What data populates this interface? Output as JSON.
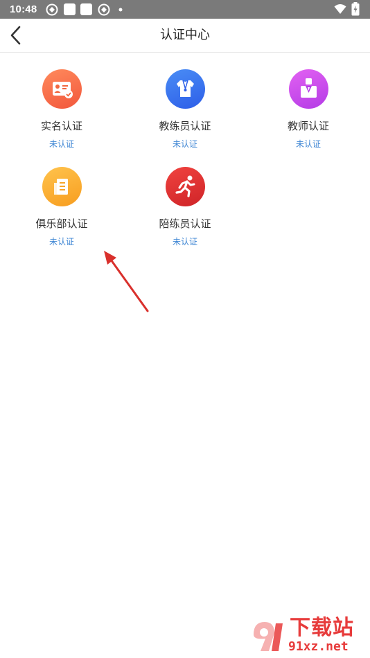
{
  "status_bar": {
    "time": "10:48"
  },
  "header": {
    "title": "认证中心"
  },
  "certifications": [
    {
      "name": "实名认证",
      "status": "未认证",
      "icon": "id-card-icon",
      "color_from": "#ff8a5c",
      "color_to": "#f2573c"
    },
    {
      "name": "教练员认证",
      "status": "未认证",
      "icon": "coach-shirt-icon",
      "color_from": "#4a8df5",
      "color_to": "#2d5ee8"
    },
    {
      "name": "教师认证",
      "status": "未认证",
      "icon": "teacher-icon",
      "color_from": "#e262f2",
      "color_to": "#b43be6"
    },
    {
      "name": "俱乐部认证",
      "status": "未认证",
      "icon": "club-building-icon",
      "color_from": "#ffc34d",
      "color_to": "#f79d1f"
    },
    {
      "name": "陪练员认证",
      "status": "未认证",
      "icon": "running-man-icon",
      "color_from": "#f0433f",
      "color_to": "#cf2428"
    }
  ],
  "colors": {
    "status_text": "#3f86d4",
    "annotation_arrow": "#d9302c"
  },
  "watermark": {
    "brand": "下载站",
    "domain": "91xz.net"
  }
}
